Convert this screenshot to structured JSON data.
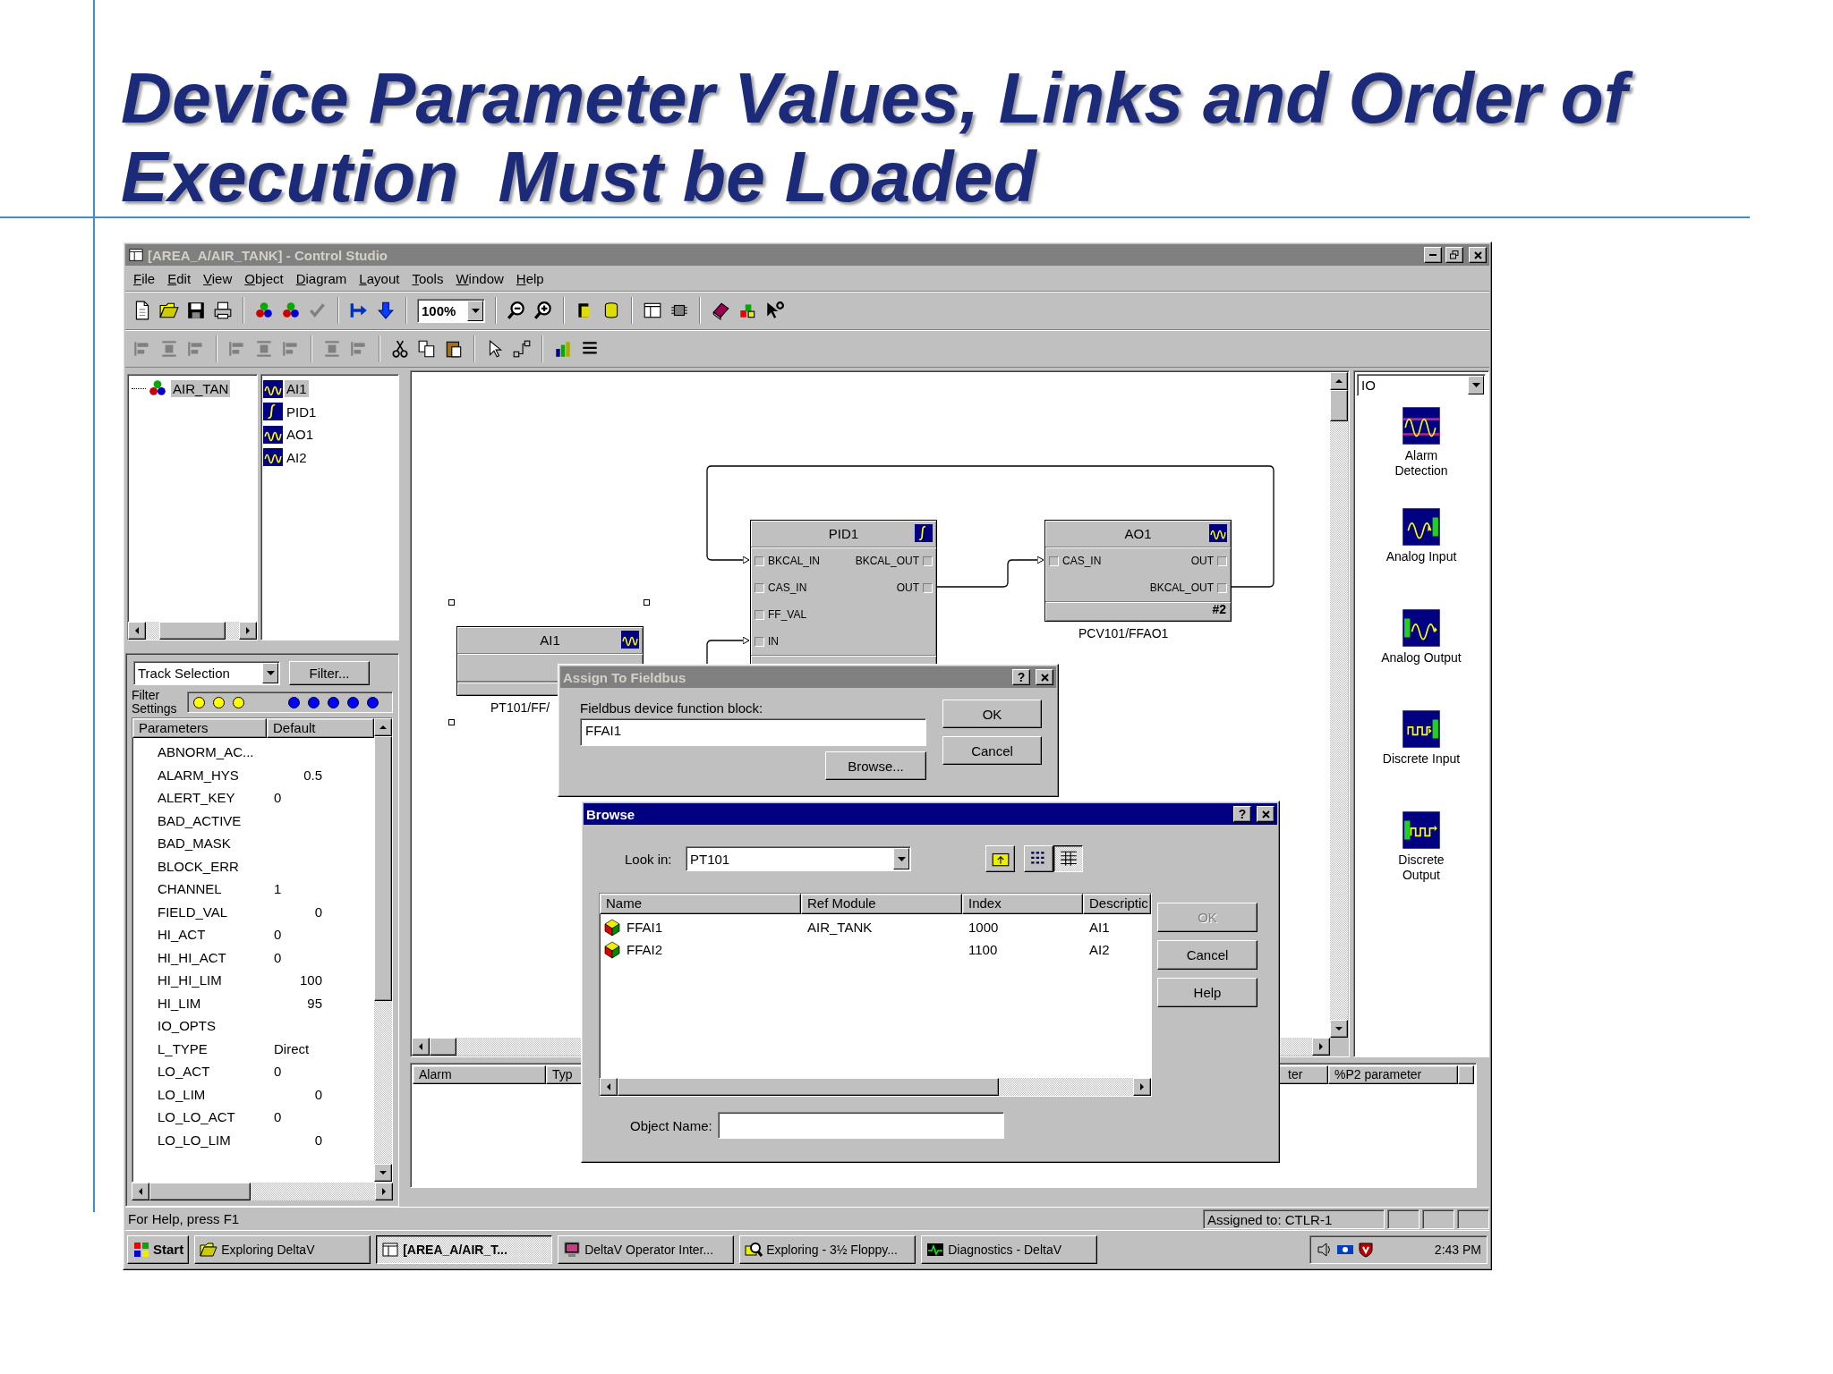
{
  "slide": {
    "title": "Device Parameter Values, Links and Order of Execution  Must be Loaded"
  },
  "window": {
    "title": "[AREA_A/AIR_TANK] - Control Studio",
    "active": false
  },
  "menu": [
    "File",
    "Edit",
    "View",
    "Object",
    "Diagram",
    "Layout",
    "Tools",
    "Window",
    "Help"
  ],
  "toolbar": {
    "zoom": "100%"
  },
  "tree": {
    "root": {
      "label": "AIR_TAN",
      "selected": true
    },
    "items": [
      {
        "label": "AI1",
        "kind": "analog",
        "selected": true
      },
      {
        "label": "PID1",
        "kind": "pid",
        "selected": false
      },
      {
        "label": "AO1",
        "kind": "analog",
        "selected": false
      },
      {
        "label": "AI2",
        "kind": "analog",
        "selected": false
      }
    ]
  },
  "parameters": {
    "selector": "Track Selection",
    "filter_button": "Filter...",
    "filter_label": "Filter Settings",
    "filter_dots": [
      {
        "color": "#ffff00"
      },
      {
        "color": "#ffff00"
      },
      {
        "color": "#ffff00"
      },
      {
        "color": "#0000ff"
      },
      {
        "color": "#0000ff"
      },
      {
        "color": "#0000ff"
      },
      {
        "color": "#0000ff"
      },
      {
        "color": "#0000ff"
      }
    ],
    "columns": [
      "Parameters",
      "Default"
    ],
    "rows": [
      {
        "name": "ABNORM_AC..."
      },
      {
        "name": "ALARM_HYS",
        "value": "0.5",
        "kind": "float"
      },
      {
        "name": "ALERT_KEY",
        "value": "0",
        "kind": "integer"
      },
      {
        "name": "BAD_ACTIVE"
      },
      {
        "name": "BAD_MASK"
      },
      {
        "name": "BLOCK_ERR"
      },
      {
        "name": "CHANNEL",
        "value": "1",
        "kind": "integer"
      },
      {
        "name": "FIELD_VAL",
        "value": "0",
        "kind": "float"
      },
      {
        "name": "HI_ACT",
        "value": "0",
        "kind": "integer"
      },
      {
        "name": "HI_HI_ACT",
        "value": "0",
        "kind": "integer"
      },
      {
        "name": "HI_HI_LIM",
        "value": "100",
        "kind": "float"
      },
      {
        "name": "HI_LIM",
        "value": "95",
        "kind": "float"
      },
      {
        "name": "IO_OPTS"
      },
      {
        "name": "L_TYPE",
        "value": "Direct",
        "kind": "text"
      },
      {
        "name": "LO_ACT",
        "value": "0",
        "kind": "integer"
      },
      {
        "name": "LO_LIM",
        "value": "0",
        "kind": "float"
      },
      {
        "name": "LO_LO_ACT",
        "value": "0",
        "kind": "integer"
      },
      {
        "name": "LO_LO_LIM",
        "value": "0",
        "kind": "float"
      }
    ]
  },
  "diagram": {
    "blocks": [
      {
        "title": "PID1",
        "kind": "pid",
        "selected": false,
        "rows": [
          {
            "in": "BKCAL_IN",
            "out": "BKCAL_OUT"
          },
          {
            "in": "CAS_IN",
            "out": "OUT"
          },
          {
            "in": "FF_VAL"
          },
          {
            "in": "IN"
          }
        ]
      },
      {
        "title": "AO1",
        "kind": "analog",
        "selected": false,
        "rows": [
          {
            "in": "CAS_IN",
            "out": "OUT"
          },
          {
            "out": "BKCAL_OUT"
          }
        ],
        "footer": "#2",
        "tag": "PCV101/FFAO1"
      },
      {
        "title": "AI1",
        "kind": "analog",
        "selected": true,
        "tag": "PT101/FF/"
      }
    ]
  },
  "palette": {
    "category": "IO",
    "items": [
      {
        "label": "Alarm Detection",
        "kind": "alarm"
      },
      {
        "label": "Analog Input",
        "kind": "analog-in"
      },
      {
        "label": "Analog Output",
        "kind": "analog-out"
      },
      {
        "label": "Discrete Input",
        "kind": "discrete-in"
      },
      {
        "label": "Discrete Output",
        "kind": "discrete-out"
      }
    ]
  },
  "alarms": {
    "columns": [
      "Alarm",
      "Typ",
      "ter",
      "%P2 parameter"
    ]
  },
  "status_bar": {
    "help": "For Help, press F1",
    "assigned": "Assigned to: CTLR-1"
  },
  "taskbar": {
    "start": "Start",
    "tasks": [
      {
        "label": "Exploring DeltaV",
        "kind": "explorer",
        "selected": false
      },
      {
        "label": "[AREA_A/AIR_T...",
        "kind": "studio",
        "selected": true
      },
      {
        "label": "DeltaV Operator Inter...",
        "kind": "monitor",
        "selected": false
      },
      {
        "label": "Exploring - 3½ Floppy...",
        "kind": "search",
        "selected": false
      },
      {
        "label": "Diagnostics - DeltaV",
        "kind": "diagnostics",
        "selected": false
      }
    ],
    "clock": "2:43 PM"
  },
  "assign_dialog": {
    "title": "Assign To Fieldbus",
    "active": false,
    "help_button": "?",
    "label": "Fieldbus device function block:",
    "value": "FFAI1",
    "browse": "Browse...",
    "buttons": [
      "OK",
      "Cancel"
    ]
  },
  "browse_dialog": {
    "title": "Browse",
    "active": true,
    "help_button": "?",
    "look_in_label": "Look in:",
    "look_in": "PT101",
    "view_modes": [
      {
        "kind": "list",
        "selected": false
      },
      {
        "kind": "details",
        "selected": true
      }
    ],
    "columns": [
      "Name",
      "Ref Module",
      "Index",
      "Descriptic"
    ],
    "rows": [
      {
        "name": "FFAI1",
        "ref_module": "AIR_TANK",
        "index": "1000",
        "description": "AI1"
      },
      {
        "name": "FFAI2",
        "index": "1100",
        "description": "AI2"
      }
    ],
    "buttons": [
      {
        "label": "OK",
        "disabled": true
      },
      {
        "label": "Cancel",
        "disabled": false
      },
      {
        "label": "Help",
        "disabled": false
      }
    ],
    "object_name_label": "Object Name:"
  }
}
